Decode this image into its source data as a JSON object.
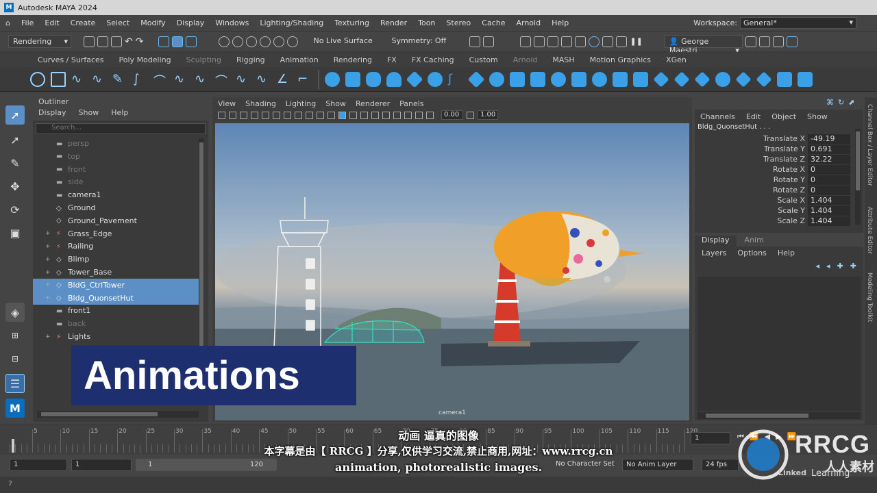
{
  "app": {
    "title": "Autodesk MAYA 2024",
    "logo": "M"
  },
  "menu": [
    "File",
    "Edit",
    "Create",
    "Select",
    "Modify",
    "Display",
    "Windows",
    "Lighting/Shading",
    "Texturing",
    "Render",
    "Toon",
    "Stereo",
    "Cache",
    "Arnold",
    "Help"
  ],
  "workspace": {
    "label": "Workspace:",
    "value": "General*"
  },
  "status": {
    "mode": "Rendering",
    "live_surface": "No Live Surface",
    "symmetry": "Symmetry: Off",
    "user": "George Maestri"
  },
  "shelf_tabs": [
    "Curves / Surfaces",
    "Poly Modeling",
    "Sculpting",
    "Rigging",
    "Animation",
    "Rendering",
    "FX",
    "FX Caching",
    "Custom",
    "Arnold",
    "MASH",
    "Motion Graphics",
    "XGen"
  ],
  "outliner": {
    "title": "Outliner",
    "menu": [
      "Display",
      "Show",
      "Help"
    ],
    "search_placeholder": "Search...",
    "items": [
      {
        "label": "persp",
        "icon": "camera-icon",
        "hidden": true,
        "expand": ""
      },
      {
        "label": "top",
        "icon": "camera-icon",
        "hidden": true,
        "expand": ""
      },
      {
        "label": "front",
        "icon": "camera-icon",
        "hidden": true,
        "expand": ""
      },
      {
        "label": "side",
        "icon": "camera-icon",
        "hidden": true,
        "expand": ""
      },
      {
        "label": "camera1",
        "icon": "camera-icon",
        "hidden": false,
        "expand": ""
      },
      {
        "label": "Ground",
        "icon": "mesh-icon",
        "hidden": false,
        "expand": ""
      },
      {
        "label": "Ground_Pavement",
        "icon": "mesh-icon",
        "hidden": false,
        "expand": ""
      },
      {
        "label": "Grass_Edge",
        "icon": "group-icon",
        "hidden": false,
        "expand": "+"
      },
      {
        "label": "Railing",
        "icon": "group-icon",
        "hidden": false,
        "expand": "+"
      },
      {
        "label": "Blimp",
        "icon": "mesh-icon",
        "hidden": false,
        "expand": "+"
      },
      {
        "label": "Tower_Base",
        "icon": "mesh-icon",
        "hidden": false,
        "expand": "+"
      },
      {
        "label": "BldG_CtrlTower",
        "icon": "mesh-icon",
        "hidden": false,
        "expand": "+",
        "selected": true
      },
      {
        "label": "Bldg_QuonsetHut",
        "icon": "mesh-icon",
        "hidden": false,
        "expand": "+",
        "selected": true
      },
      {
        "label": "front1",
        "icon": "camera-icon",
        "hidden": false,
        "expand": ""
      },
      {
        "label": "back",
        "icon": "camera-icon",
        "hidden": true,
        "expand": ""
      },
      {
        "label": "Lights",
        "icon": "group-icon",
        "hidden": false,
        "expand": "+"
      }
    ]
  },
  "viewport": {
    "menu": [
      "View",
      "Shading",
      "Lighting",
      "Show",
      "Renderer",
      "Panels"
    ],
    "field1": "0.00",
    "field2": "1.00",
    "camera_label": "camera1"
  },
  "channels": {
    "menu": [
      "Channels",
      "Edit",
      "Object",
      "Show"
    ],
    "object": "Bldg_QuonsetHut . . .",
    "attrs": [
      {
        "name": "Translate X",
        "value": "-49.19"
      },
      {
        "name": "Translate Y",
        "value": "0.691"
      },
      {
        "name": "Translate Z",
        "value": "32.22"
      },
      {
        "name": "Rotate X",
        "value": "0"
      },
      {
        "name": "Rotate Y",
        "value": "0"
      },
      {
        "name": "Rotate Z",
        "value": "0"
      },
      {
        "name": "Scale X",
        "value": "1.404"
      },
      {
        "name": "Scale Y",
        "value": "1.404"
      },
      {
        "name": "Scale Z",
        "value": "1.404"
      }
    ]
  },
  "layers": {
    "tabs": [
      "Display",
      "Anim"
    ],
    "menu": [
      "Layers",
      "Options",
      "Help"
    ]
  },
  "side_tabs": [
    "Channel Box / Layer Editor",
    "Attribute Editor",
    "Modeling Toolkit"
  ],
  "timeline": {
    "ticks": [
      "5",
      "10",
      "15",
      "20",
      "25",
      "30",
      "35",
      "40",
      "45",
      "50",
      "55",
      "60",
      "65",
      "70",
      "75",
      "80",
      "85",
      "90",
      "95",
      "100",
      "105",
      "110",
      "115",
      "120"
    ],
    "current": "1",
    "start": "1"
  },
  "range": {
    "start": "1",
    "start2": "1",
    "slider_start": "1",
    "slider_end": "120",
    "character": "No Character Set",
    "anim_layer": "No Anim Layer",
    "fps": "24 fps"
  },
  "overlay": {
    "banner": "Animations",
    "sub_cn_1": "动画 逼真的图像",
    "sub_cn_2": "本字幕是由【 RRCG 】分享,仅供学习交流,禁止商用,网址：www.rrcg.cn",
    "sub_en": "animation, photorealistic images.",
    "wm_name": "RRCG",
    "wm_cn": "人人素材",
    "wm_learning": "Learning",
    "wm_linked": "Linked"
  }
}
